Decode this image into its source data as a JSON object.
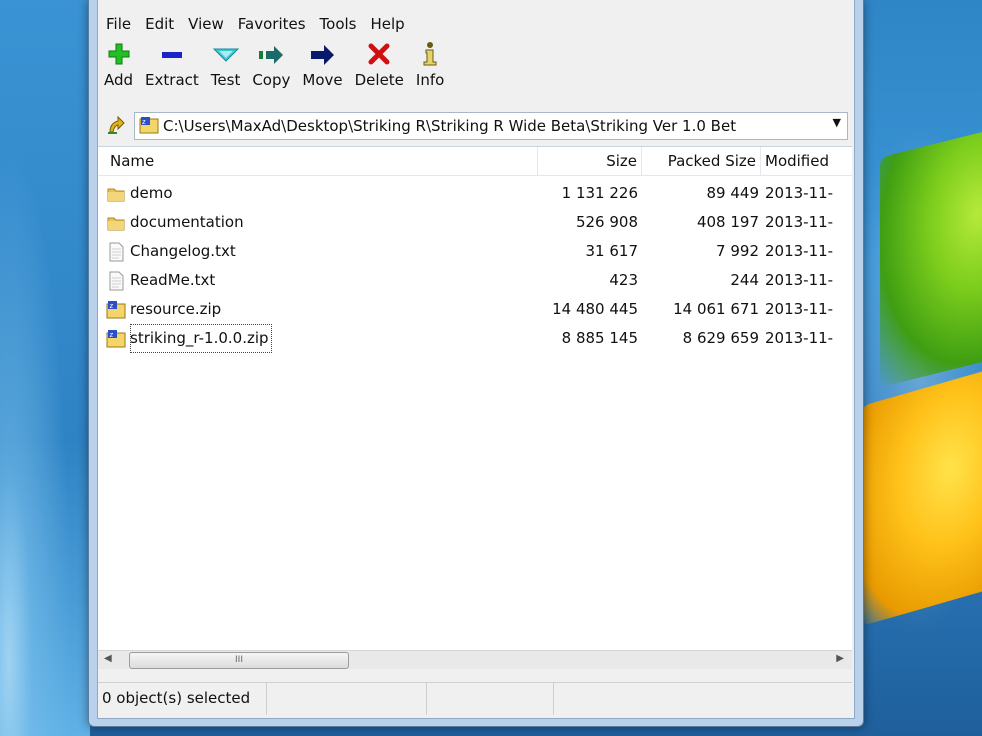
{
  "menu": [
    "File",
    "Edit",
    "View",
    "Favorites",
    "Tools",
    "Help"
  ],
  "toolbar": [
    {
      "label": "Add",
      "icon": "plus-icon",
      "color": "#1fb51f"
    },
    {
      "label": "Extract",
      "icon": "minus-icon",
      "color": "#1a22c8"
    },
    {
      "label": "Test",
      "icon": "check-chevron-icon",
      "color": "#20b5c5"
    },
    {
      "label": "Copy",
      "icon": "double-arrow-icon",
      "color": "#1a7a3a"
    },
    {
      "label": "Move",
      "icon": "arrow-right-icon",
      "color": "#0a1a6a"
    },
    {
      "label": "Delete",
      "icon": "red-x-icon",
      "color": "#d01010"
    },
    {
      "label": "Info",
      "icon": "info-icon",
      "color": "#9a7a10"
    }
  ],
  "address": {
    "path": "C:\\Users\\MaxAd\\Desktop\\Striking R\\Striking R Wide Beta\\Striking Ver 1.0 Bet"
  },
  "columns": {
    "name": "Name",
    "size": "Size",
    "packed": "Packed Size",
    "modified": "Modified"
  },
  "files": [
    {
      "name": "demo",
      "type": "folder",
      "size": "1 131 226",
      "packed": "89 449",
      "modified": "2013-11-"
    },
    {
      "name": "documentation",
      "type": "folder",
      "size": "526 908",
      "packed": "408 197",
      "modified": "2013-11-"
    },
    {
      "name": "Changelog.txt",
      "type": "text",
      "size": "31 617",
      "packed": "7 992",
      "modified": "2013-11-"
    },
    {
      "name": "ReadMe.txt",
      "type": "text",
      "size": "423",
      "packed": "244",
      "modified": "2013-11-"
    },
    {
      "name": "resource.zip",
      "type": "zip",
      "size": "14 480 445",
      "packed": "14 061 671",
      "modified": "2013-11-"
    },
    {
      "name": "striking_r-1.0.0.zip",
      "type": "zip",
      "size": "8 885 145",
      "packed": "8 629 659",
      "modified": "2013-11-"
    }
  ],
  "scrollbar": {
    "thumb_grip": "III"
  },
  "status": {
    "text": "0 object(s) selected"
  }
}
